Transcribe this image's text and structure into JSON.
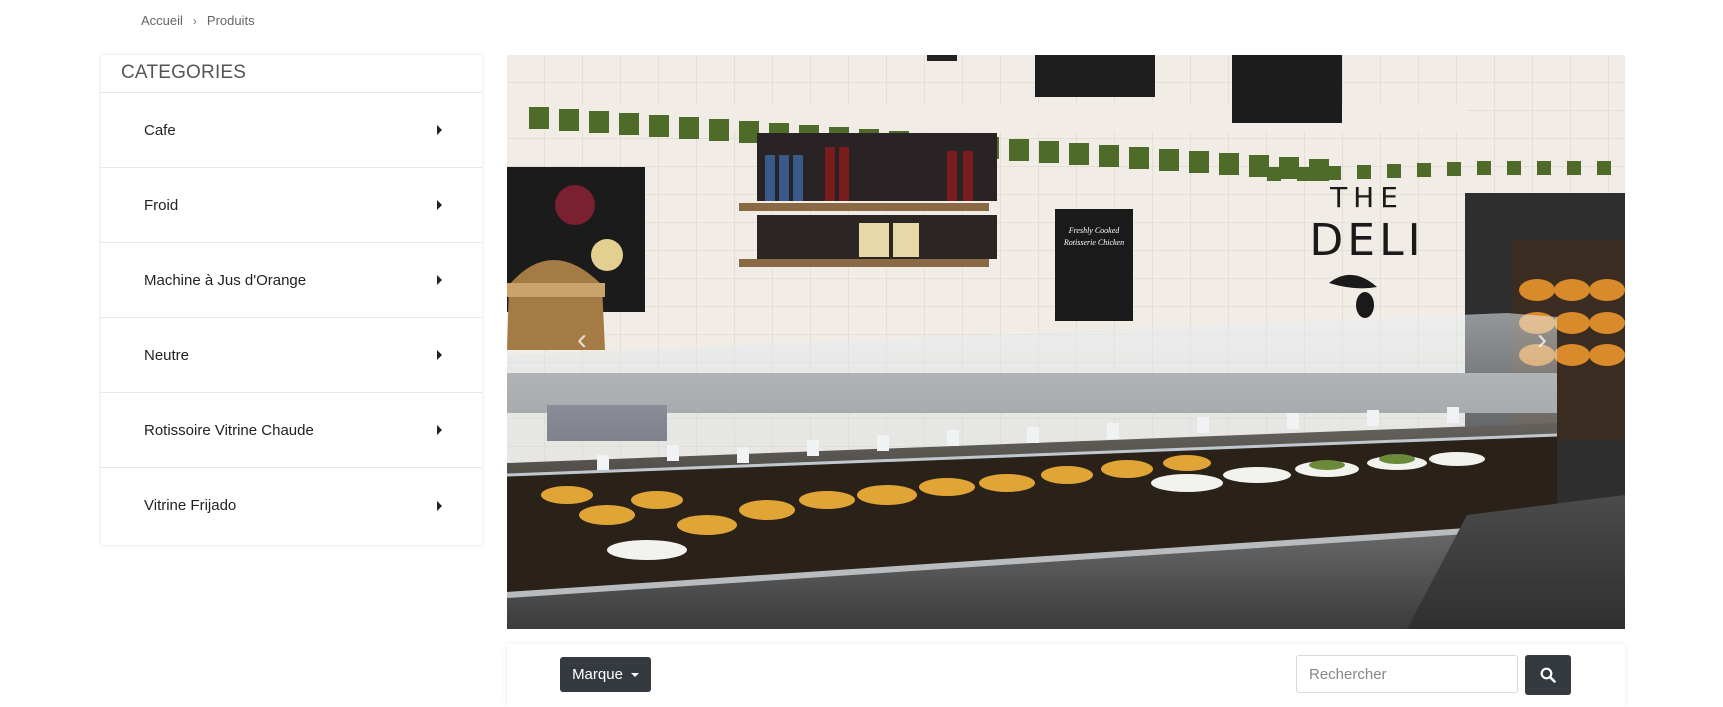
{
  "breadcrumb": {
    "home": "Accueil",
    "separator": "›",
    "current": "Produits"
  },
  "sidebar": {
    "title": "CATEGORIES",
    "items": [
      {
        "label": "Cafe"
      },
      {
        "label": "Froid"
      },
      {
        "label": "Machine à Jus d'Orange"
      },
      {
        "label": "Neutre"
      },
      {
        "label": "Rotissoire Vitrine Chaude"
      },
      {
        "label": "Vitrine Frijado"
      }
    ]
  },
  "carousel": {
    "image_sign_line1": "THE",
    "image_sign_line2": "DELI",
    "menu_board_line1": "Freshly Cooked",
    "menu_board_line2": "Rotisserie Chicken",
    "prev_icon": "chevron-left-icon",
    "next_icon": "chevron-right-icon"
  },
  "toolbar": {
    "brand_label": "Marque",
    "search_placeholder": "Rechercher",
    "search_icon": "search-icon"
  },
  "colors": {
    "dark_button": "#343a40",
    "border": "#e6e6e6"
  }
}
